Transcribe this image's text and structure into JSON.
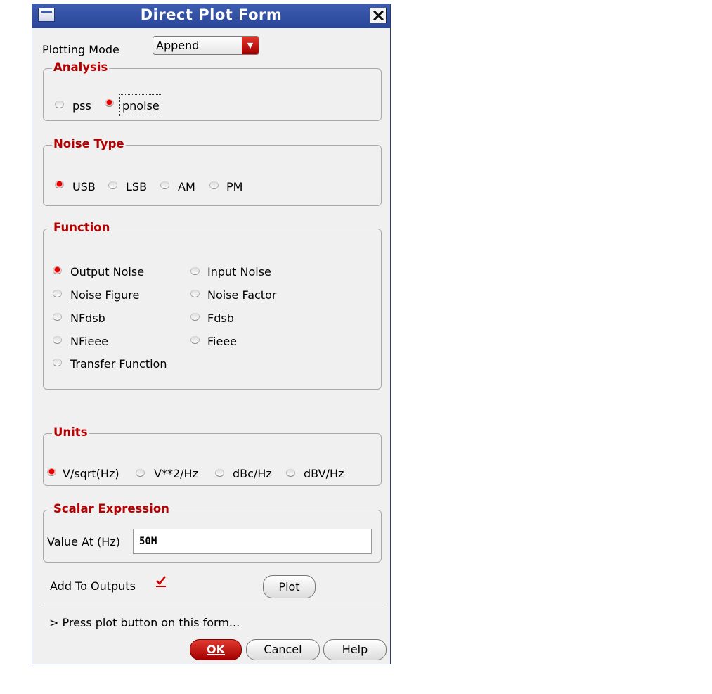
{
  "window": {
    "title": "Direct Plot Form"
  },
  "plotting_mode": {
    "label": "Plotting Mode",
    "value": "Append"
  },
  "analysis": {
    "legend": "Analysis",
    "options": [
      {
        "label": "pss",
        "selected": false
      },
      {
        "label": "pnoise",
        "selected": true
      }
    ]
  },
  "noise_type": {
    "legend": "Noise Type",
    "options": [
      {
        "label": "USB",
        "selected": true
      },
      {
        "label": "LSB",
        "selected": false
      },
      {
        "label": "AM",
        "selected": false
      },
      {
        "label": "PM",
        "selected": false
      }
    ]
  },
  "function": {
    "legend": "Function",
    "options": [
      {
        "label": "Output Noise",
        "selected": true
      },
      {
        "label": "Input Noise",
        "selected": false
      },
      {
        "label": "Noise Figure",
        "selected": false
      },
      {
        "label": "Noise Factor",
        "selected": false
      },
      {
        "label": "NFdsb",
        "selected": false
      },
      {
        "label": "Fdsb",
        "selected": false
      },
      {
        "label": "NFieee",
        "selected": false
      },
      {
        "label": "Fieee",
        "selected": false
      },
      {
        "label": "Transfer Function",
        "selected": false
      }
    ]
  },
  "units": {
    "legend": "Units",
    "options": [
      {
        "label": "V/sqrt(Hz)",
        "selected": true
      },
      {
        "label": "V**2/Hz",
        "selected": false
      },
      {
        "label": "dBc/Hz",
        "selected": false
      },
      {
        "label": "dBV/Hz",
        "selected": false
      }
    ]
  },
  "scalar_expression": {
    "legend": "Scalar Expression",
    "label": "Value At (Hz)",
    "value": "50M"
  },
  "add_to_outputs": {
    "label": "Add To Outputs",
    "checked": true
  },
  "buttons": {
    "plot": "Plot",
    "ok": "OK",
    "cancel": "Cancel",
    "help": "Help"
  },
  "status_message": "> Press plot button on this form..."
}
